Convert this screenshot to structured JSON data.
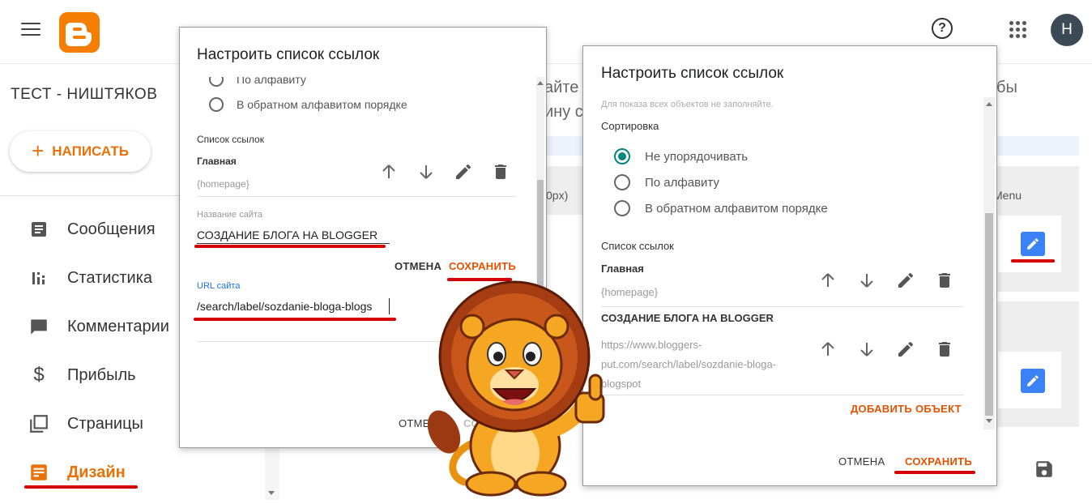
{
  "topbar": {
    "help_glyph": "?",
    "avatar_letter": "Н"
  },
  "sidebar": {
    "blog_title": "ТЕСТ - НИШТЯКОВ",
    "write_plus": "+",
    "write_label": "НАПИСАТЬ",
    "items": [
      {
        "label": "Сообщения",
        "icon": "posts-icon"
      },
      {
        "label": "Статистика",
        "icon": "stats-icon"
      },
      {
        "label": "Комментарии",
        "icon": "comments-icon"
      },
      {
        "label": "Прибыль",
        "icon": "earnings-icon"
      },
      {
        "label": "Страницы",
        "icon": "pages-icon"
      },
      {
        "label": "Дизайн",
        "icon": "layout-icon",
        "active": true
      }
    ]
  },
  "background": {
    "frag1": "айте",
    "frag2": "ину ст",
    "frag3": "0px)",
    "frag4": "бы",
    "frag5": "Menu"
  },
  "dialog_left": {
    "title": "Настроить список ссылок",
    "sort_options": [
      "По алфавиту",
      "В обратном алфавитом порядке"
    ],
    "links_heading": "Список ссылок",
    "link1_name": "Главная",
    "link1_url": "{homepage}",
    "site_name_label": "Название сайта",
    "site_name_value": "СОЗДАНИЕ БЛОГА НА BLOGGER",
    "cancel": "ОТМЕНА",
    "save": "СОХРАНИТЬ",
    "url_label": "URL сайта",
    "url_value": "/search/label/sozdanie-bloga-blogs",
    "bottom_cancel": "ОТМЕ",
    "bottom_save": "СО"
  },
  "dialog_right": {
    "title": "Настроить список ссылок",
    "hint": "Для показа всех объектов не заполняйте.",
    "sort_label": "Сортировка",
    "sort_options": [
      {
        "label": "Не упорядочивать",
        "checked": true
      },
      {
        "label": "По алфавиту",
        "checked": false
      },
      {
        "label": "В обратном алфавитом порядке",
        "checked": false
      }
    ],
    "links_heading": "Список ссылок",
    "link1_name": "Главная",
    "link1_url": "{homepage}",
    "link2_name": "СОЗДАНИЕ БЛОГА НА BLOGGER",
    "link2_url_lines": [
      "https://www.bloggers-",
      "put.com/search/label/sozdanie-bloga-",
      "blogspot"
    ],
    "add_item": "ДОБАВИТЬ ОБЪЕКТ",
    "cancel": "ОТМЕНА",
    "save": "СОХРАНИТЬ"
  },
  "colors": {
    "accent": "#e8710a",
    "save_red": "#e65100",
    "highlight_red": "#d50000",
    "radio_teal": "#00897b",
    "edit_blue": "#3b82f6"
  }
}
